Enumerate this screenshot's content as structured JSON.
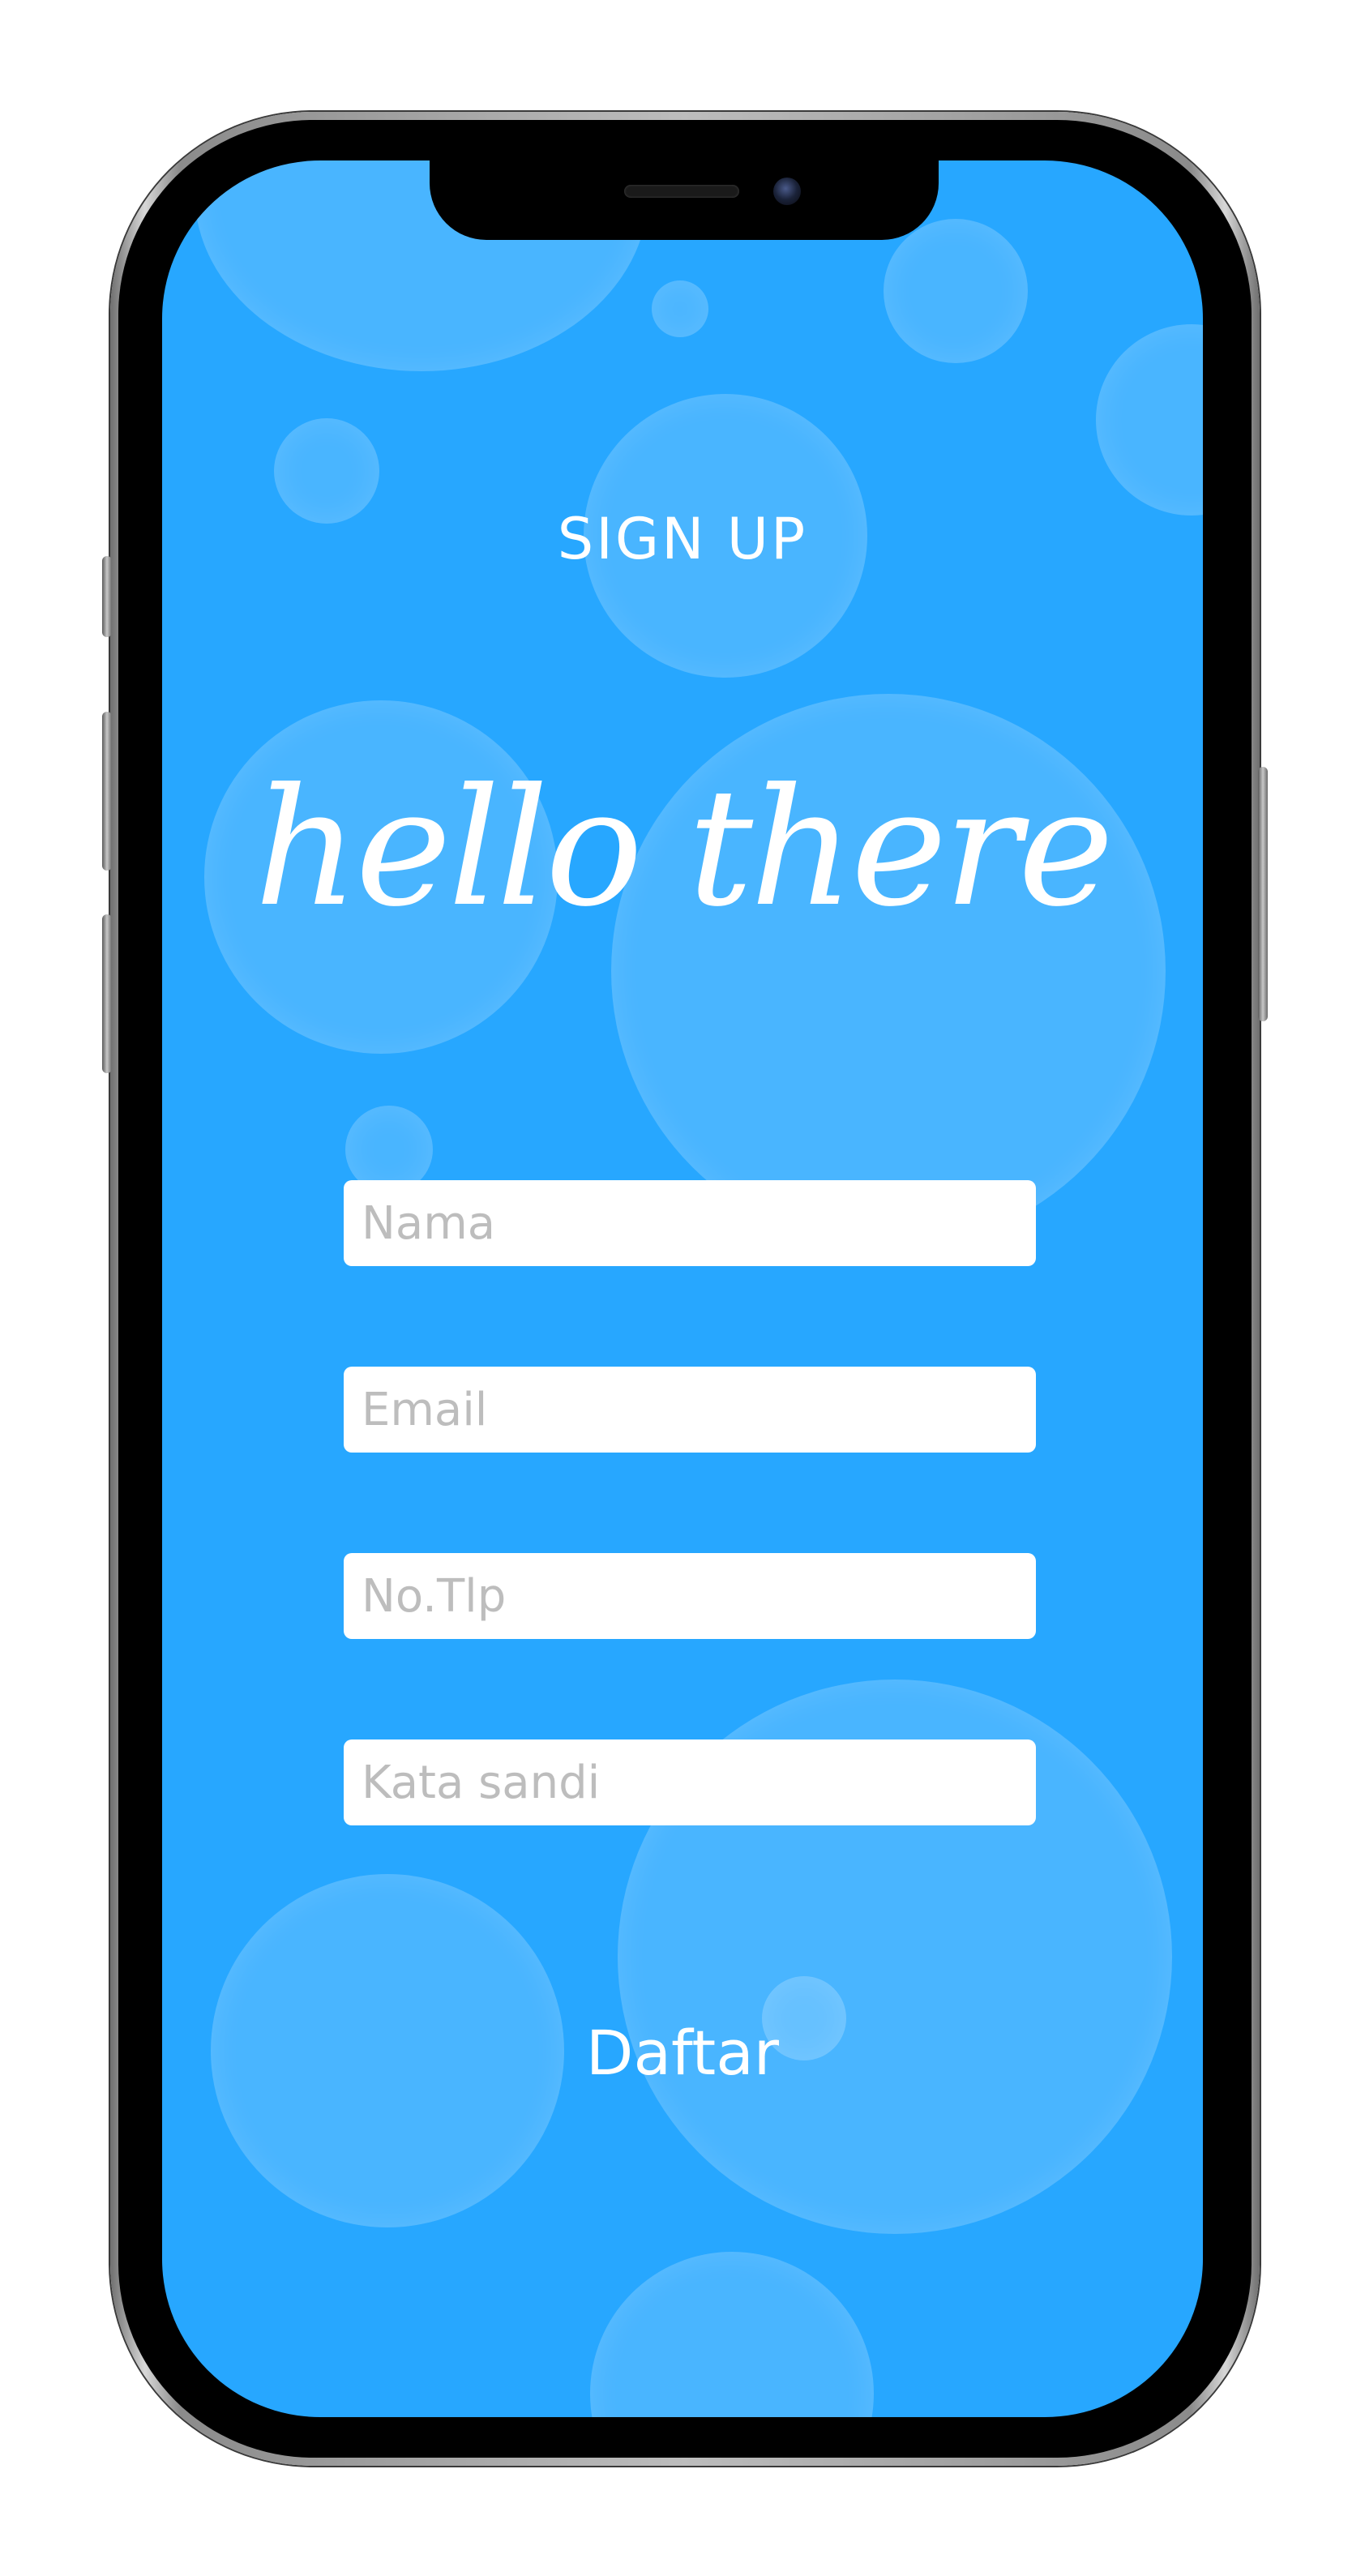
{
  "screen": {
    "title": "SIGN UP",
    "greeting": "hello there",
    "background_color": "#27a7ff"
  },
  "form": {
    "name_placeholder": "Nama",
    "email_placeholder": "Email",
    "phone_placeholder": "No.Tlp",
    "password_placeholder": "Kata sandi",
    "submit_label": "Daftar"
  }
}
